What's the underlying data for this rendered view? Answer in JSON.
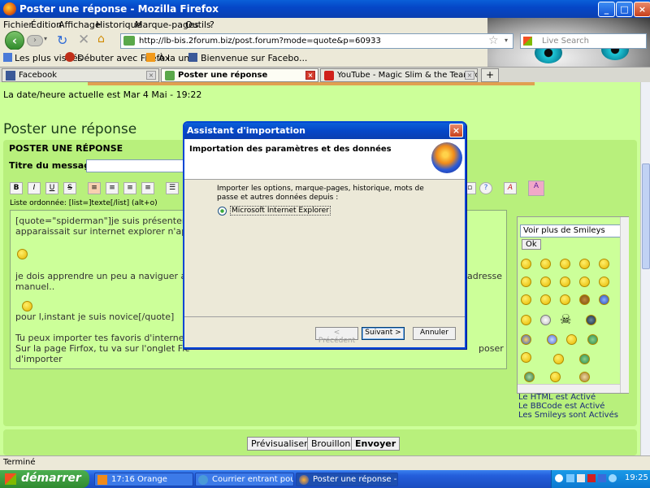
{
  "window": {
    "title": "Poster une réponse - Mozilla Firefox",
    "min": "_",
    "max": "□",
    "close": "×"
  },
  "menu": [
    "Fichier",
    "Édition",
    "Affichage",
    "Historique",
    "Marque-pages",
    "Outils",
    "?"
  ],
  "nav": {
    "url": "http://lb-bis.2forum.biz/post.forum?mode=quote&p=60933",
    "search_placeholder": "Live Search"
  },
  "bookmarks": [
    "Les plus visités",
    "Débuter avec Firefox",
    "À la une",
    "Bienvenue sur Facebo..."
  ],
  "tabs": [
    {
      "label": "Facebook"
    },
    {
      "label": "Poster une réponse"
    },
    {
      "label": "YouTube - Magic Slim & the Teardrops - ..."
    }
  ],
  "page": {
    "datetime": "La date/heure actuelle est Mar 4 Mai - 19:22",
    "heading": "Poster une réponse",
    "panel_header": "POSTER UNE RÉPONSE",
    "title_label": "Titre du message",
    "list_hint": "Liste ordonnée: [list=]texte[/list] (alt+o)",
    "toolbar": [
      "B",
      "I",
      "U",
      "S"
    ],
    "message_lines": [
      "[quote=\"spiderman\"]je suis présentement",
      "apparaissait sur internet explorer n'appa",
      "je dois apprendre un peu a naviguer ave",
      "adresse",
      "manuel..",
      "pour l,instant je suis novice[/quote]",
      "Tu peux importer tes favoris d'internet e",
      "Sur la page Firfox, tu va sur l'onglet Fic",
      "poser",
      "d'importer"
    ],
    "smiley_select": "Voir plus de Smileys",
    "ok": "Ok",
    "status_html": "Le HTML est Activé",
    "status_bbcode": "Le BBCode est Activé",
    "status_smileys": "Les Smileys sont Activés",
    "buttons": [
      "Prévisualiser",
      "Brouillon",
      "Envoyer"
    ]
  },
  "dialog": {
    "title": "Assistant d'importation",
    "close": "×",
    "header": "Importation des paramètres et des données",
    "prompt": "Importer les options, marque-pages, historique, mots de passe et autres données depuis :",
    "option": "Microsoft Internet Explorer",
    "back": "< Précédent",
    "next": "Suivant >",
    "cancel": "Annuler"
  },
  "statusbar": "Terminé",
  "taskbar": {
    "start": "démarrer",
    "tasks": [
      "17:16 Orange",
      "Courrier entrant pour...",
      "Poster une réponse - ..."
    ],
    "clock": "19:25"
  }
}
